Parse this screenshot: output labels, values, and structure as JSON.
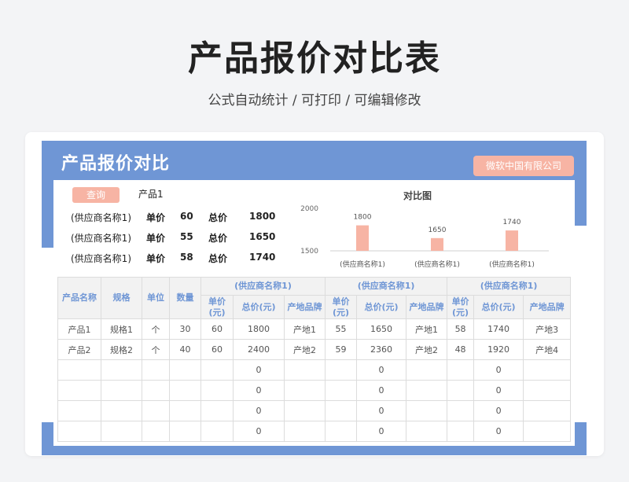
{
  "page": {
    "title": "产品报价对比表",
    "subtitle": "公式自动统计  / 可打印 /  可编辑修改"
  },
  "header": {
    "title": "产品报价对比",
    "company": "微软中国有限公司"
  },
  "query": {
    "button_label": "查询",
    "selected_product": "产品1"
  },
  "summary": {
    "price_label": "单价",
    "total_label": "总价",
    "rows": [
      {
        "supplier": "(供应商名称1)",
        "price": "60",
        "total": "1800"
      },
      {
        "supplier": "(供应商名称1)",
        "price": "55",
        "total": "1650"
      },
      {
        "supplier": "(供应商名称1)",
        "price": "58",
        "total": "1740"
      }
    ]
  },
  "chart_data": {
    "type": "bar",
    "title": "对比图",
    "categories": [
      "(供应商名称1)",
      "(供应商名称1)",
      "(供应商名称1)"
    ],
    "values": [
      1800,
      1650,
      1740
    ],
    "ylim": [
      1500,
      2000
    ],
    "yticks": [
      "2000",
      "1500"
    ],
    "bar_color": "#f7b4a4",
    "grid": false
  },
  "table": {
    "fixed_headers": [
      "产品名称",
      "规格",
      "单位",
      "数量"
    ],
    "group_headers": [
      "(供应商名称1)",
      "(供应商名称1)",
      "(供应商名称1)"
    ],
    "sub_headers": [
      "单价(元)",
      "总价(元)",
      "产地品牌"
    ],
    "rows": [
      [
        "产品1",
        "规格1",
        "个",
        "30",
        "60",
        "1800",
        "产地1",
        "55",
        "1650",
        "产地1",
        "58",
        "1740",
        "产地3"
      ],
      [
        "产品2",
        "规格2",
        "个",
        "40",
        "60",
        "2400",
        "产地2",
        "59",
        "2360",
        "产地2",
        "48",
        "1920",
        "产地4"
      ],
      [
        "",
        "",
        "",
        "",
        "",
        "0",
        "",
        "",
        "0",
        "",
        "",
        "0",
        ""
      ],
      [
        "",
        "",
        "",
        "",
        "",
        "0",
        "",
        "",
        "0",
        "",
        "",
        "0",
        ""
      ],
      [
        "",
        "",
        "",
        "",
        "",
        "0",
        "",
        "",
        "0",
        "",
        "",
        "0",
        ""
      ],
      [
        "",
        "",
        "",
        "",
        "",
        "0",
        "",
        "",
        "0",
        "",
        "",
        "0",
        ""
      ]
    ]
  },
  "colors": {
    "accent_blue": "#6f96d5",
    "accent_pink": "#f7b4a4"
  }
}
